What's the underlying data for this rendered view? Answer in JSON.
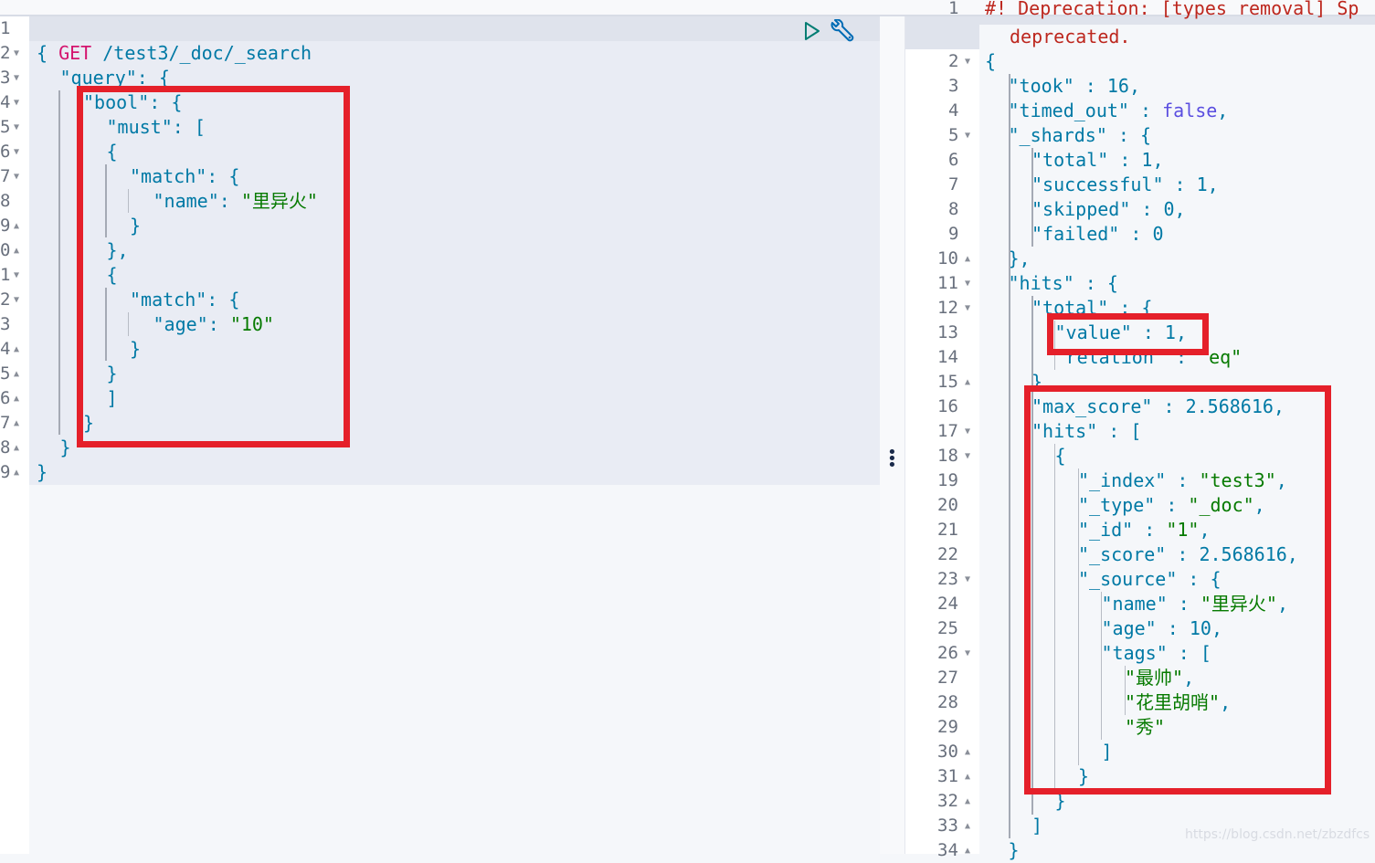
{
  "request": {
    "method": "GET",
    "path": " /test3/_doc/_search",
    "line_numbers": [
      "1",
      "2",
      "3",
      "4",
      "5",
      "6",
      "7",
      "8",
      "9",
      "0",
      "1",
      "2",
      "3",
      "4",
      "5",
      "6",
      "7",
      "8",
      "9"
    ],
    "folds": [
      "",
      "▼",
      "▼",
      "▼",
      "▼",
      "▼",
      "▼",
      "",
      "▲",
      "▲",
      "▼",
      "▼",
      "",
      "▲",
      "▲",
      "▲",
      "▲",
      "▲",
      "▲"
    ],
    "lines": [
      {
        "indent": 0,
        "tokens": [
          [
            "p",
            "{"
          ]
        ]
      },
      {
        "indent": 1,
        "tokens": [
          [
            "k",
            "\"query\""
          ],
          [
            "p",
            ": {"
          ]
        ]
      },
      {
        "indent": 2,
        "tokens": [
          [
            "k",
            "\"bool\""
          ],
          [
            "p",
            ": {"
          ]
        ]
      },
      {
        "indent": 3,
        "tokens": [
          [
            "k",
            "\"must\""
          ],
          [
            "p",
            ": ["
          ]
        ]
      },
      {
        "indent": 3,
        "tokens": [
          [
            "p",
            "{"
          ]
        ]
      },
      {
        "indent": 4,
        "tokens": [
          [
            "k",
            "\"match\""
          ],
          [
            "p",
            ": {"
          ]
        ]
      },
      {
        "indent": 5,
        "tokens": [
          [
            "k",
            "\"name\""
          ],
          [
            "p",
            ": "
          ],
          [
            "s",
            "\"里异火\""
          ]
        ]
      },
      {
        "indent": 4,
        "tokens": [
          [
            "p",
            "}"
          ]
        ]
      },
      {
        "indent": 3,
        "tokens": [
          [
            "p",
            "},"
          ]
        ]
      },
      {
        "indent": 3,
        "tokens": [
          [
            "p",
            "{"
          ]
        ]
      },
      {
        "indent": 4,
        "tokens": [
          [
            "k",
            "\"match\""
          ],
          [
            "p",
            ": {"
          ]
        ]
      },
      {
        "indent": 5,
        "tokens": [
          [
            "k",
            "\"age\""
          ],
          [
            "p",
            ": "
          ],
          [
            "s",
            "\"10\""
          ]
        ]
      },
      {
        "indent": 4,
        "tokens": [
          [
            "p",
            "}"
          ]
        ]
      },
      {
        "indent": 3,
        "tokens": [
          [
            "p",
            "}"
          ]
        ]
      },
      {
        "indent": 3,
        "tokens": [
          [
            "p",
            "]"
          ]
        ]
      },
      {
        "indent": 2,
        "tokens": [
          [
            "p",
            "}"
          ]
        ]
      },
      {
        "indent": 1,
        "tokens": [
          [
            "p",
            "}"
          ]
        ]
      },
      {
        "indent": 0,
        "tokens": [
          [
            "p",
            "}"
          ]
        ]
      }
    ]
  },
  "toolbar": {
    "run_icon": "play-icon",
    "settings_icon": "wrench-icon"
  },
  "response": {
    "deprecation_line": "#! Deprecation: [types removal] Sp",
    "deprecation_wrap": "deprecated.",
    "line_numbers": [
      "2",
      "3",
      "4",
      "5",
      "6",
      "7",
      "8",
      "9",
      "10",
      "11",
      "12",
      "13",
      "14",
      "15",
      "16",
      "17",
      "18",
      "19",
      "20",
      "21",
      "22",
      "23",
      "24",
      "25",
      "26",
      "27",
      "28",
      "29",
      "30",
      "31",
      "32",
      "33",
      "34"
    ],
    "folds": [
      "▼",
      "",
      "",
      "▼",
      "",
      "",
      "",
      "",
      "▲",
      "▼",
      "▼",
      "",
      "",
      "▲",
      "",
      "▼",
      "▼",
      "",
      "",
      "",
      "",
      "▼",
      "",
      "",
      "▼",
      "",
      "",
      "",
      "▲",
      "▲",
      "▲",
      "▲",
      "▲"
    ],
    "lines": [
      {
        "indent": 0,
        "tokens": [
          [
            "p",
            "{"
          ]
        ]
      },
      {
        "indent": 1,
        "tokens": [
          [
            "k",
            "\"took\""
          ],
          [
            "p",
            " : "
          ],
          [
            "n",
            "16"
          ],
          [
            "p",
            ","
          ]
        ]
      },
      {
        "indent": 1,
        "tokens": [
          [
            "k",
            "\"timed_out\""
          ],
          [
            "p",
            " : "
          ],
          [
            "b",
            "false"
          ],
          [
            "p",
            ","
          ]
        ]
      },
      {
        "indent": 1,
        "tokens": [
          [
            "k",
            "\"_shards\""
          ],
          [
            "p",
            " : {"
          ]
        ]
      },
      {
        "indent": 2,
        "tokens": [
          [
            "k",
            "\"total\""
          ],
          [
            "p",
            " : "
          ],
          [
            "n",
            "1"
          ],
          [
            "p",
            ","
          ]
        ]
      },
      {
        "indent": 2,
        "tokens": [
          [
            "k",
            "\"successful\""
          ],
          [
            "p",
            " : "
          ],
          [
            "n",
            "1"
          ],
          [
            "p",
            ","
          ]
        ]
      },
      {
        "indent": 2,
        "tokens": [
          [
            "k",
            "\"skipped\""
          ],
          [
            "p",
            " : "
          ],
          [
            "n",
            "0"
          ],
          [
            "p",
            ","
          ]
        ]
      },
      {
        "indent": 2,
        "tokens": [
          [
            "k",
            "\"failed\""
          ],
          [
            "p",
            " : "
          ],
          [
            "n",
            "0"
          ]
        ]
      },
      {
        "indent": 1,
        "tokens": [
          [
            "p",
            "},"
          ]
        ]
      },
      {
        "indent": 1,
        "tokens": [
          [
            "k",
            "\"hits\""
          ],
          [
            "p",
            " : {"
          ]
        ]
      },
      {
        "indent": 2,
        "tokens": [
          [
            "k",
            "\"total\""
          ],
          [
            "p",
            " : {"
          ]
        ]
      },
      {
        "indent": 3,
        "tokens": [
          [
            "k",
            "\"value\""
          ],
          [
            "p",
            " : "
          ],
          [
            "n",
            "1"
          ],
          [
            "p",
            ","
          ]
        ]
      },
      {
        "indent": 3,
        "tokens": [
          [
            "k",
            "\"relation\""
          ],
          [
            "p",
            " : "
          ],
          [
            "s",
            "\"eq\""
          ]
        ]
      },
      {
        "indent": 2,
        "tokens": [
          [
            "p",
            "},"
          ]
        ]
      },
      {
        "indent": 2,
        "tokens": [
          [
            "k",
            "\"max_score\""
          ],
          [
            "p",
            " : "
          ],
          [
            "n",
            "2.568616"
          ],
          [
            "p",
            ","
          ]
        ]
      },
      {
        "indent": 2,
        "tokens": [
          [
            "k",
            "\"hits\""
          ],
          [
            "p",
            " : ["
          ]
        ]
      },
      {
        "indent": 3,
        "tokens": [
          [
            "p",
            "{"
          ]
        ]
      },
      {
        "indent": 4,
        "tokens": [
          [
            "k",
            "\"_index\""
          ],
          [
            "p",
            " : "
          ],
          [
            "s",
            "\"test3\""
          ],
          [
            "p",
            ","
          ]
        ]
      },
      {
        "indent": 4,
        "tokens": [
          [
            "k",
            "\"_type\""
          ],
          [
            "p",
            " : "
          ],
          [
            "s",
            "\"_doc\""
          ],
          [
            "p",
            ","
          ]
        ]
      },
      {
        "indent": 4,
        "tokens": [
          [
            "k",
            "\"_id\""
          ],
          [
            "p",
            " : "
          ],
          [
            "s",
            "\"1\""
          ],
          [
            "p",
            ","
          ]
        ]
      },
      {
        "indent": 4,
        "tokens": [
          [
            "k",
            "\"_score\""
          ],
          [
            "p",
            " : "
          ],
          [
            "n",
            "2.568616"
          ],
          [
            "p",
            ","
          ]
        ]
      },
      {
        "indent": 4,
        "tokens": [
          [
            "k",
            "\"_source\""
          ],
          [
            "p",
            " : {"
          ]
        ]
      },
      {
        "indent": 5,
        "tokens": [
          [
            "k",
            "\"name\""
          ],
          [
            "p",
            " : "
          ],
          [
            "s",
            "\"里异火\""
          ],
          [
            "p",
            ","
          ]
        ]
      },
      {
        "indent": 5,
        "tokens": [
          [
            "k",
            "\"age\""
          ],
          [
            "p",
            " : "
          ],
          [
            "n",
            "10"
          ],
          [
            "p",
            ","
          ]
        ]
      },
      {
        "indent": 5,
        "tokens": [
          [
            "k",
            "\"tags\""
          ],
          [
            "p",
            " : ["
          ]
        ]
      },
      {
        "indent": 6,
        "tokens": [
          [
            "s",
            "\"最帅\""
          ],
          [
            "p",
            ","
          ]
        ]
      },
      {
        "indent": 6,
        "tokens": [
          [
            "s",
            "\"花里胡哨\""
          ],
          [
            "p",
            ","
          ]
        ]
      },
      {
        "indent": 6,
        "tokens": [
          [
            "s",
            "\"秀\""
          ]
        ]
      },
      {
        "indent": 5,
        "tokens": [
          [
            "p",
            "]"
          ]
        ]
      },
      {
        "indent": 4,
        "tokens": [
          [
            "p",
            "}"
          ]
        ]
      },
      {
        "indent": 3,
        "tokens": [
          [
            "p",
            "}"
          ]
        ]
      },
      {
        "indent": 2,
        "tokens": [
          [
            "p",
            "]"
          ]
        ]
      },
      {
        "indent": 1,
        "tokens": [
          [
            "p",
            "}"
          ]
        ]
      }
    ]
  },
  "watermark": "https://blog.csdn.net/zbzdfcs",
  "colors": {
    "highlight_box": "#e5202a",
    "key": "#0079a5",
    "string": "#067a00",
    "method": "#d4146e",
    "boolean": "#5a4ee0",
    "warning": "#bd271e"
  }
}
